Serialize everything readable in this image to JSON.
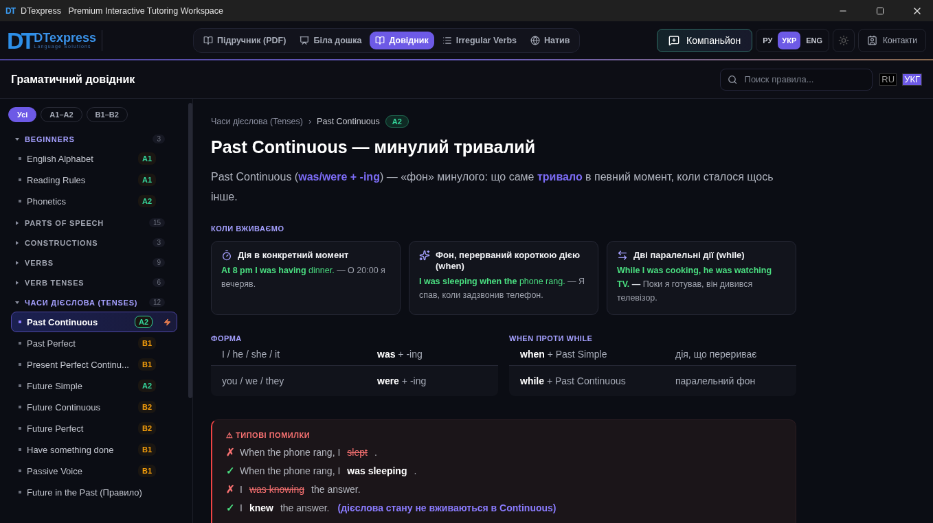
{
  "window": {
    "title": "DTexpress   Premium Interactive Tutoring Workspace",
    "logo": "DT"
  },
  "header": {
    "logo": {
      "mark": "DT",
      "name": "DTexpress",
      "tagline": "Language Solutions"
    },
    "tabs": [
      {
        "label": "Підручник (PDF)",
        "selected": false
      },
      {
        "label": "Біла дошка",
        "selected": false
      },
      {
        "label": "Довідник",
        "selected": true
      },
      {
        "label": "Irregular Verbs",
        "selected": false
      },
      {
        "label": "Натив",
        "selected": false
      }
    ],
    "companion": "Компаньйон",
    "languages": [
      {
        "label": "РУ",
        "selected": false
      },
      {
        "label": "УКР",
        "selected": true
      },
      {
        "label": "ENG",
        "selected": false
      }
    ],
    "contacts": "Контакти"
  },
  "subheader": {
    "title": "Граматичний довідник",
    "search": {
      "placeholder": "Поиск правила..."
    },
    "languages": [
      {
        "label": "RU",
        "selected": false
      },
      {
        "label": "УКГ",
        "selected": true
      }
    ]
  },
  "sidebar": {
    "filters": [
      {
        "label": "Усі",
        "selected": true
      },
      {
        "label": "A1–A2",
        "selected": false
      },
      {
        "label": "B1–B2",
        "selected": false
      }
    ],
    "groups": [
      {
        "title": "BEGINNERS",
        "count": "3",
        "expanded": true,
        "items": [
          {
            "label": "English Alphabet",
            "level": "A1",
            "color": "#34d399",
            "selected": false
          },
          {
            "label": "Reading Rules",
            "level": "A1",
            "color": "#34d399",
            "selected": false
          },
          {
            "label": "Phonetics",
            "level": "A2",
            "color": "#34d399",
            "selected": false
          }
        ]
      },
      {
        "title": "PARTS OF SPEECH",
        "count": "15",
        "expanded": false
      },
      {
        "title": "CONSTRUCTIONS",
        "count": "3",
        "expanded": false
      },
      {
        "title": "VERBS",
        "count": "9",
        "expanded": false
      },
      {
        "title": "VERB TENSES",
        "count": "6",
        "expanded": false
      },
      {
        "title": "ЧАСИ ДІЄСЛОВА (TENSES)",
        "count": "12",
        "expanded": true,
        "items": [
          {
            "label": "Past Continuous",
            "level": "A2",
            "color": "#34d399",
            "selected": true
          },
          {
            "label": "Past Perfect",
            "level": "B1",
            "color": "#f59e0b",
            "selected": false
          },
          {
            "label": "Present Perfect Continu...",
            "level": "B1",
            "color": "#f59e0b",
            "selected": false
          },
          {
            "label": "Future Simple",
            "level": "A2",
            "color": "#34d399",
            "selected": false
          },
          {
            "label": "Future Continuous",
            "level": "B2",
            "color": "#f59e0b",
            "selected": false
          },
          {
            "label": "Future Perfect",
            "level": "B2",
            "color": "#f59e0b",
            "selected": false
          },
          {
            "label": "Have something done",
            "level": "B1",
            "color": "#f59e0b",
            "selected": false
          },
          {
            "label": "Passive Voice",
            "level": "B1",
            "color": "#f59e0b",
            "selected": false
          },
          {
            "label": "Future in the Past (Правило)",
            "selected": false
          }
        ]
      }
    ]
  },
  "article": {
    "breadcrumb": [
      "Часи дієслова (Tenses)",
      "Past Continuous"
    ],
    "breadcrumb_separator": "›",
    "level": "A2",
    "title": "Past Continuous — минулий тривалий",
    "intro": "Past Continuous (**was/were + -ing**) — «фон» минулого: що саме **тривало** в певний момент, коли сталося щось інше.",
    "usage_heading": "КОЛИ ВЖИВАЄМО",
    "usage": [
      {
        "title": "Дія в конкретний момент",
        "example": "**At 8 pm I was having** dinner.",
        "translation": "— О 20:00 я вечеряв."
      },
      {
        "title": "Фон, перерваний короткою дією (when)",
        "example": "**I was sleeping when the** phone rang.",
        "translation": "— Я спав, коли задзвонив телефон."
      },
      {
        "title": "Дві паралельні дії (while)",
        "example": "**While I was cooking, he was watching TV.**",
        "translation": "**—** Поки я готував, він дивився телевізор."
      }
    ],
    "form": {
      "heading": "ФОРМА",
      "rows": [
        {
          "subject": "I / he / she / it",
          "pattern": "**was** + -ing"
        },
        {
          "subject": "you / we / they",
          "pattern": "**were** + -ing"
        }
      ]
    },
    "when_while": {
      "heading": "WHEN ПРОТИ WHILE",
      "rows": [
        {
          "pattern": "**when** + Past Simple",
          "meaning": "дія, що перериває"
        },
        {
          "pattern": "**while** + Past Continuous",
          "meaning": "паралельний фон"
        }
      ]
    },
    "mistakes": {
      "heading": "ТИПОВІ ПОМИЛКИ",
      "icon": "⚠",
      "lines": [
        {
          "kind": "wrong",
          "mark_icon": "✗",
          "before": "When the phone rang, I",
          "word": "slept",
          "after": "."
        },
        {
          "kind": "right",
          "mark_icon": "✓",
          "before": "When the phone rang, I",
          "word": "was sleeping",
          "after": "."
        },
        {
          "kind": "wrong",
          "mark_icon": "✗",
          "before": "I",
          "word": "was knowing",
          "after": "the answer."
        },
        {
          "kind": "right",
          "mark_icon": "✓",
          "before": "I",
          "word": "knew",
          "after": "the answer.",
          "note": "(дієслова стану не вживаються в Continuous)"
        }
      ]
    }
  }
}
